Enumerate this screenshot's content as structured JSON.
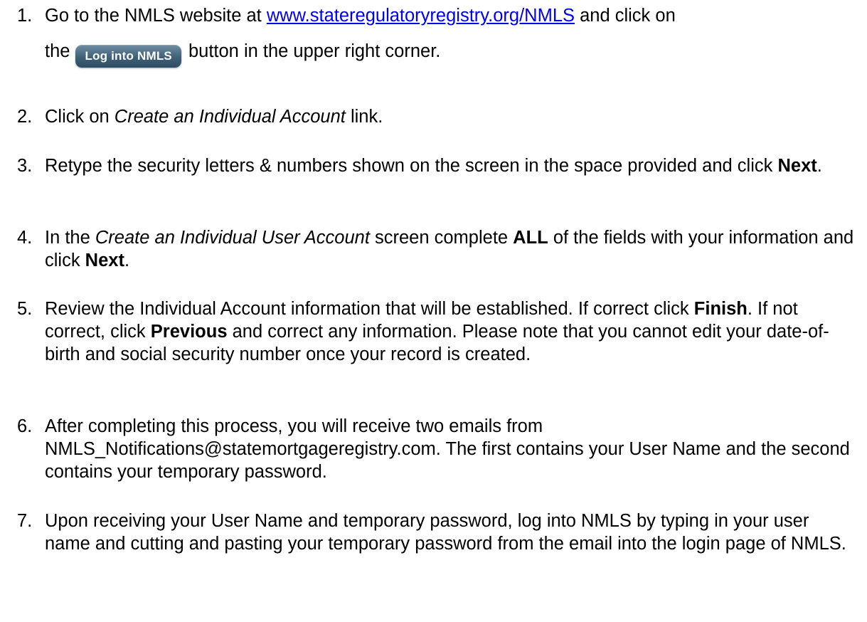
{
  "steps": [
    {
      "number": "1.",
      "line1_pre": "Go to the NMLS website at ",
      "link": "www.stateregulatoryregistry.org/NMLS",
      "line1_post": " and click on",
      "line2_pre": "the",
      "button_label": "Log into NMLS",
      "line2_post": "button in the upper right corner."
    },
    {
      "number": "2.",
      "pre": "Click on ",
      "italic": "Create an Individual Account",
      "post": " link."
    },
    {
      "number": "3.",
      "pre": "Retype the security letters & numbers shown on the screen in the space provided and click ",
      "bold": "Next",
      "post": "."
    },
    {
      "number": "4.",
      "pre": "In the ",
      "italic": "Create an Individual User Account",
      "mid": " screen complete ",
      "bold1": "ALL",
      "mid2": " of the fields with your information and click ",
      "bold2": "Next",
      "post": "."
    },
    {
      "number": "5.",
      "pre": "Review the Individual Account information that will be established.  If correct click ",
      "bold1": "Finish",
      "mid": ".  If not correct, click ",
      "bold2": "Previous",
      "post": " and correct any information.  Please note that you cannot edit your date-of-birth and social security number once your record is created."
    },
    {
      "number": "6.",
      "text": "After completing this process, you will receive two emails from NMLS_Notifications@statemortgageregistry.com.  The first contains your User Name and the second contains your temporary password."
    },
    {
      "number": "7.",
      "text": "Upon receiving your User Name and temporary password, log into NMLS by typing in your user name and cutting and pasting your temporary password from the email into the login page of NMLS."
    }
  ]
}
